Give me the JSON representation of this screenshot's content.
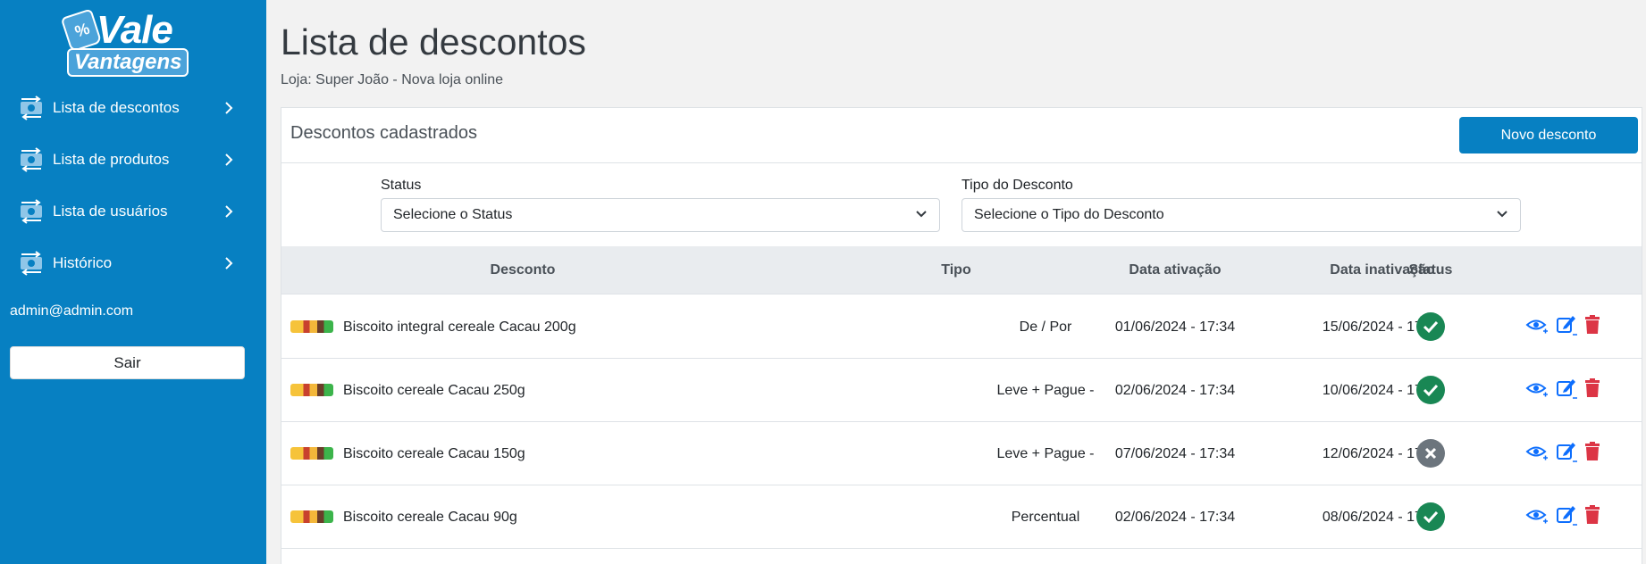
{
  "brand": {
    "logo_top": "Vale",
    "logo_bottom": "Vantagens",
    "logo_badge": "%"
  },
  "sidebar": {
    "items": [
      {
        "label": "Lista de descontos"
      },
      {
        "label": "Lista de produtos"
      },
      {
        "label": "Lista de usuários"
      },
      {
        "label": "Histórico"
      }
    ],
    "user_email": "admin@admin.com",
    "logout_label": "Sair"
  },
  "header": {
    "title": "Lista de descontos",
    "store": "Loja: Super João - Nova loja online"
  },
  "card": {
    "title": "Descontos cadastrados",
    "new_button": "Novo desconto"
  },
  "filters": {
    "status": {
      "label": "Status",
      "value": "Selecione o Status"
    },
    "type": {
      "label": "Tipo do Desconto",
      "value": "Selecione o Tipo do Desconto"
    }
  },
  "table": {
    "columns": [
      "Desconto",
      "Tipo",
      "Data ativação",
      "Data inativação",
      "Status"
    ],
    "rows": [
      {
        "product": "Biscoito integral cereale Cacau 200g",
        "type": "De / Por",
        "start": "01/06/2024 - 17:34",
        "end": "15/06/2024 - 17:34",
        "status": "active"
      },
      {
        "product": "Biscoito cereale Cacau 250g",
        "type": "Leve + Pague -",
        "start": "02/06/2024 - 17:34",
        "end": "10/06/2024 - 17:34",
        "status": "active"
      },
      {
        "product": "Biscoito cereale Cacau 150g",
        "type": "Leve + Pague -",
        "start": "07/06/2024 - 17:34",
        "end": "12/06/2024 - 17:34",
        "status": "inactive"
      },
      {
        "product": "Biscoito cereale Cacau 90g",
        "type": "Percentual",
        "start": "02/06/2024 - 17:34",
        "end": "08/06/2024 - 17:34",
        "status": "active"
      }
    ]
  },
  "colors": {
    "sidebar": "#0780c2",
    "primary_button": "#0780c2",
    "status_active": "#198754",
    "status_inactive": "#6c757d",
    "action_blue": "#0d6efd",
    "action_delete": "#dc3545"
  },
  "icons": {
    "nav": "money-transfer-icon",
    "chevron": "chevron-right-icon",
    "select": "chevron-down-icon",
    "view": "eye-icon",
    "edit": "edit-icon",
    "delete": "trash-icon",
    "status_active": "check-circle-icon",
    "status_inactive": "x-circle-icon"
  }
}
